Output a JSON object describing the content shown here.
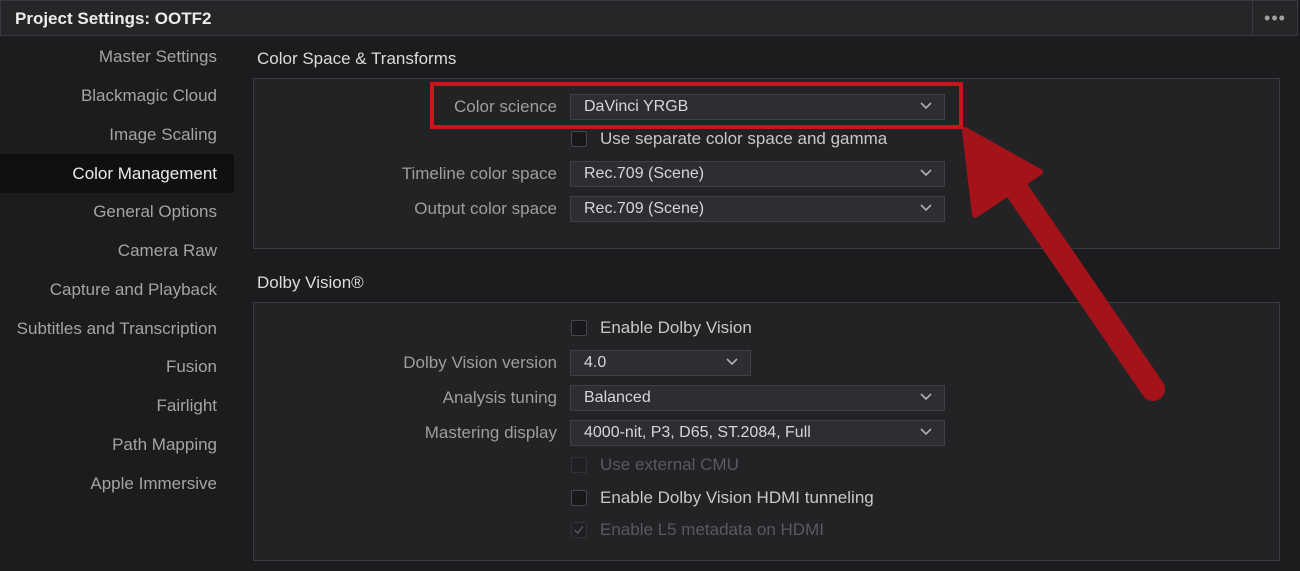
{
  "window": {
    "title": "Project Settings:  OOTF2"
  },
  "sidebar": {
    "items": [
      {
        "label": "Master Settings"
      },
      {
        "label": "Blackmagic Cloud"
      },
      {
        "label": "Image Scaling"
      },
      {
        "label": "Color Management"
      },
      {
        "label": "General Options"
      },
      {
        "label": "Camera Raw"
      },
      {
        "label": "Capture and Playback"
      },
      {
        "label": "Subtitles and Transcription"
      },
      {
        "label": "Fusion"
      },
      {
        "label": "Fairlight"
      },
      {
        "label": "Path Mapping"
      },
      {
        "label": "Apple Immersive"
      }
    ],
    "active": "Color Management"
  },
  "color_space": {
    "title": "Color Space & Transforms",
    "color_science_label": "Color science",
    "color_science_value": "DaVinci YRGB",
    "separate_label": "Use separate color space and gamma",
    "separate_checked": false,
    "timeline_label": "Timeline color space",
    "timeline_value": "Rec.709 (Scene)",
    "output_label": "Output color space",
    "output_value": "Rec.709 (Scene)"
  },
  "dolby": {
    "title": "Dolby Vision®",
    "enable_label": "Enable Dolby Vision",
    "enable_checked": false,
    "version_label": "Dolby Vision version",
    "version_value": "4.0",
    "tuning_label": "Analysis tuning",
    "tuning_value": "Balanced",
    "mastering_label": "Mastering display",
    "mastering_value": "4000-nit, P3, D65, ST.2084, Full",
    "cmu_label": "Use external CMU",
    "cmu_enabled": false,
    "hdmi_label": "Enable Dolby Vision HDMI tunneling",
    "hdmi_checked": false,
    "l5_label": "Enable L5 metadata on HDMI",
    "l5_checked": true,
    "l5_enabled": false
  },
  "colors": {
    "annotation": "#c8161c",
    "background": "#1c1c1e",
    "panel": "#232326"
  }
}
